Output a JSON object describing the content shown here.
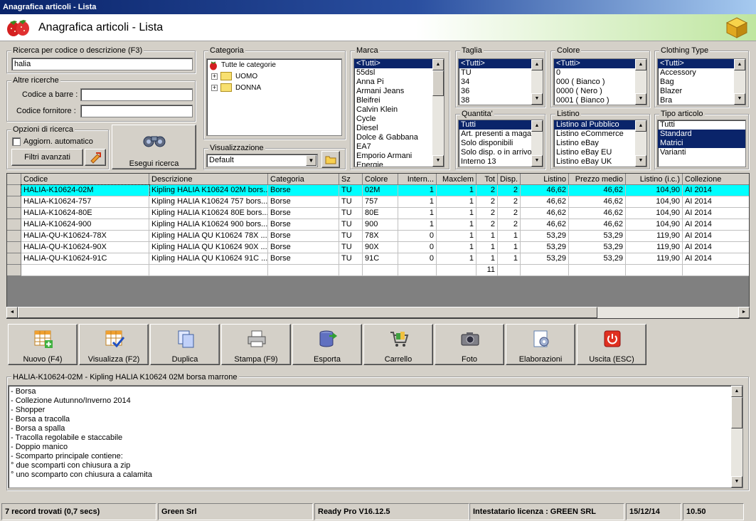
{
  "window": {
    "title": "Anagrafica articoli  - Lista"
  },
  "header": {
    "title": "Anagrafica articoli  - Lista"
  },
  "search": {
    "group_title": "Ricerca per codice o descrizione (F3)",
    "value": "halia",
    "other_title": "Altre ricerche",
    "barcode_label": "Codice a barre :",
    "barcode_value": "",
    "supplier_label": "Codice fornitore :",
    "supplier_value": ""
  },
  "options": {
    "group_title": "Opzioni di ricerca",
    "auto_update_label": "Aggiorn. automatico",
    "advanced_filters_label": "Filtri avanzati",
    "execute_label": "Esegui ricerca"
  },
  "categoria": {
    "title": "Categoria",
    "root": "Tutte le categorie",
    "nodes": [
      "UOMO",
      "DONNA"
    ]
  },
  "visualizzazione": {
    "title": "Visualizzazione",
    "value": "Default"
  },
  "marca": {
    "title": "Marca",
    "items": [
      "<Tutti>",
      "55dsl",
      "Anna Pi",
      "Armani Jeans",
      "Bleifrei",
      "Calvin Klein",
      "Cycle",
      "Diesel",
      "Dolce & Gabbana",
      "EA7",
      "Emporio Armani",
      "Energie"
    ]
  },
  "taglia": {
    "title": "Taglia",
    "items": [
      "<Tutti>",
      "TU",
      "34",
      "36",
      "38"
    ]
  },
  "colore": {
    "title": "Colore",
    "items": [
      "<Tutti>",
      "0",
      "000 ( Bianco )",
      "0000 ( Nero )",
      "0001 ( Bianco )"
    ]
  },
  "clothing": {
    "title": "Clothing Type",
    "items": [
      "<Tutti>",
      "Accessory",
      "Bag",
      "Blazer",
      "Bra"
    ]
  },
  "quantita": {
    "title": "Quantita'",
    "items": [
      "Tutti",
      "Art. presenti a magazzino",
      "Solo disponibili",
      "Solo disp. o in arrivo",
      "Interno 13"
    ]
  },
  "listino": {
    "title": "Listino",
    "items": [
      "Listino al Pubblico",
      "Listino eCommerce",
      "Listino eBay",
      "Listino eBay EU",
      "Listino eBay UK"
    ]
  },
  "tipo": {
    "title": "Tipo articolo",
    "items": [
      "Tutti",
      "Standard",
      "Matrici",
      "Varianti"
    ]
  },
  "grid": {
    "columns": [
      "Codice",
      "Descrizione",
      "Categoria",
      "Sz",
      "Colore",
      "Intern...",
      "Maxclem",
      "Tot",
      "Disp.",
      "Listino",
      "Prezzo medio",
      "Listino (i.c.)",
      "Collezione"
    ],
    "rows": [
      [
        "HALIA-K10624-02M",
        "Kipling HALIA K10624 02M bors...",
        "Borse",
        "TU",
        "02M",
        "1",
        "1",
        "2",
        "2",
        "46,62",
        "46,62",
        "104,90",
        "AI 2014"
      ],
      [
        "HALIA-K10624-757",
        "Kipling HALIA K10624 757 bors...",
        "Borse",
        "TU",
        "757",
        "1",
        "1",
        "2",
        "2",
        "46,62",
        "46,62",
        "104,90",
        "AI 2014"
      ],
      [
        "HALIA-K10624-80E",
        "Kipling HALIA K10624 80E bors...",
        "Borse",
        "TU",
        "80E",
        "1",
        "1",
        "2",
        "2",
        "46,62",
        "46,62",
        "104,90",
        "AI 2014"
      ],
      [
        "HALIA-K10624-900",
        "Kipling HALIA K10624 900 bors...",
        "Borse",
        "TU",
        "900",
        "1",
        "1",
        "2",
        "2",
        "46,62",
        "46,62",
        "104,90",
        "AI 2014"
      ],
      [
        "HALIA-QU-K10624-78X",
        "Kipling HALIA QU K10624 78X ...",
        "Borse",
        "TU",
        "78X",
        "0",
        "1",
        "1",
        "1",
        "53,29",
        "53,29",
        "119,90",
        "AI 2014"
      ],
      [
        "HALIA-QU-K10624-90X",
        "Kipling HALIA QU K10624 90X ...",
        "Borse",
        "TU",
        "90X",
        "0",
        "1",
        "1",
        "1",
        "53,29",
        "53,29",
        "119,90",
        "AI 2014"
      ],
      [
        "HALIA-QU-K10624-91C",
        "Kipling HALIA QU K10624 91C ...",
        "Borse",
        "TU",
        "91C",
        "0",
        "1",
        "1",
        "1",
        "53,29",
        "53,29",
        "119,90",
        "AI 2014"
      ]
    ],
    "total_tot": "11"
  },
  "toolbar": {
    "new": "Nuovo (F4)",
    "view": "Visualizza (F2)",
    "duplicate": "Duplica",
    "print": "Stampa (F9)",
    "export": "Esporta",
    "cart": "Carrello",
    "photo": "Foto",
    "process": "Elaborazioni",
    "exit": "Uscita (ESC)"
  },
  "detail": {
    "title": "HALIA-K10624-02M - Kipling HALIA K10624 02M borsa marrone",
    "lines": [
      "- Borsa",
      "- Collezione Autunno/Inverno  2014",
      "- Shopper",
      "- Borsa a tracolla",
      "- Borsa a spalla",
      "- Tracolla regolabile e staccabile",
      "- Doppio manico",
      "- Scomparto principale contiene:",
      "° due scomparti con chiusura a zip",
      "° uno scomparto con chiusura a calamita"
    ]
  },
  "status": {
    "records": "7 record trovati (0,7 secs)",
    "company": "Green Srl",
    "version": "Ready Pro V16.12.5",
    "license": "Intestatario licenza : GREEN SRL",
    "date": "15/12/14",
    "time": "10.50"
  },
  "colors": {
    "selection": "#0a246a",
    "grid_selected_row": "#00ffff",
    "titlebar": "#0a246a"
  }
}
